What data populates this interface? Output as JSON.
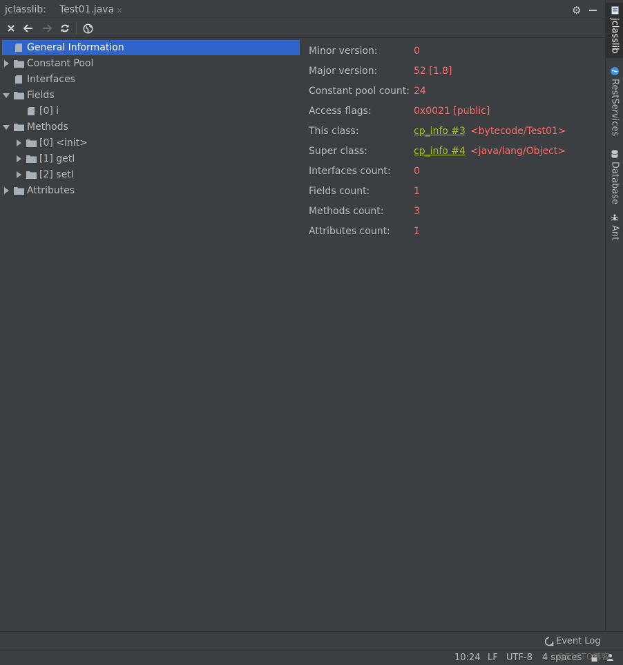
{
  "header": {
    "tool_title": "jclasslib:",
    "tab_title": "Test01.java",
    "tab_close": "×"
  },
  "toolbar": {
    "close": "close-icon",
    "back": "back-arrow-icon",
    "forward": "forward-arrow-icon",
    "reload": "reload-icon",
    "browser": "globe-icon"
  },
  "tree": {
    "general": "General Information",
    "constant_pool": "Constant Pool",
    "interfaces": "Interfaces",
    "fields": "Fields",
    "field0": "[0] i",
    "methods": "Methods",
    "method0": "[0] <init>",
    "method1": "[1] getI",
    "method2": "[2] setI",
    "attributes": "Attributes"
  },
  "details": {
    "minor_version": {
      "label": "Minor version:",
      "value": "0"
    },
    "major_version": {
      "label": "Major version:",
      "value": "52 [1.8]"
    },
    "constant_pool_count": {
      "label": "Constant pool count:",
      "value": "24"
    },
    "access_flags": {
      "label": "Access flags:",
      "value": "0x0021 [public]"
    },
    "this_class": {
      "label": "This class:",
      "link": "cp_info #3",
      "value": "<bytecode/Test01>"
    },
    "super_class": {
      "label": "Super class:",
      "link": "cp_info #4",
      "value": "<java/lang/Object>"
    },
    "interfaces_count": {
      "label": "Interfaces count:",
      "value": "0"
    },
    "fields_count": {
      "label": "Fields count:",
      "value": "1"
    },
    "methods_count": {
      "label": "Methods count:",
      "value": "3"
    },
    "attributes_count": {
      "label": "Attributes count:",
      "value": "1"
    }
  },
  "rightbar": {
    "jclasslib": "jclasslib",
    "rest_services": "RestServices",
    "database": "Database",
    "ant": "Ant"
  },
  "eventbar": {
    "event_log": "Event Log"
  },
  "statusbar": {
    "position": "10:24",
    "line_sep": "LF",
    "encoding": "UTF-8",
    "indent": "4 spaces",
    "watermark": "@51CTO博客"
  },
  "colors": {
    "background": "#3c3f41",
    "selection": "#2f65ca",
    "value": "#ff6b68",
    "link": "#a8c023"
  }
}
